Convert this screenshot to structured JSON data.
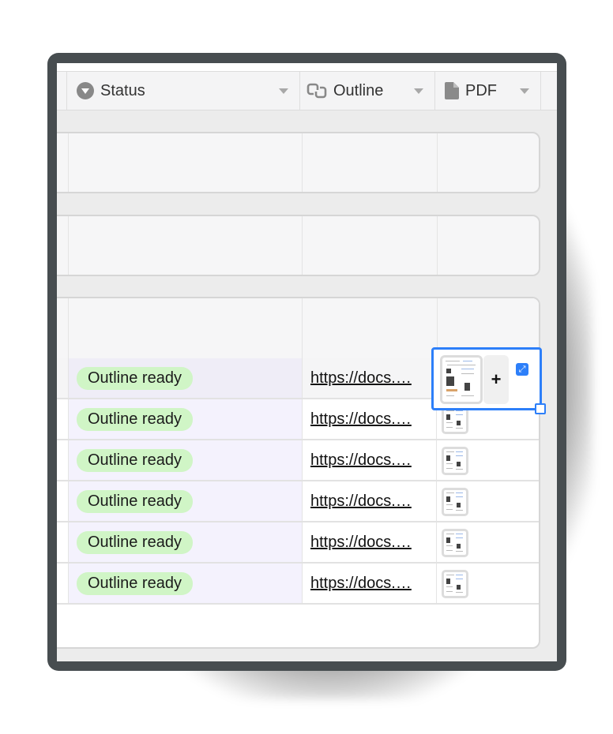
{
  "columns": [
    {
      "label": "Status",
      "icon": "single-select-icon"
    },
    {
      "label": "Outline",
      "icon": "link-icon"
    },
    {
      "label": "PDF",
      "icon": "document-icon"
    }
  ],
  "plus_label": "+",
  "expand_glyph": "⤢",
  "rows": [
    {
      "status": "Outline ready",
      "outline": "https://docs.…"
    },
    {
      "status": "Outline ready",
      "outline": "https://docs.…"
    },
    {
      "status": "Outline ready",
      "outline": "https://docs.…"
    },
    {
      "status": "Outline ready",
      "outline": "https://docs.…"
    },
    {
      "status": "Outline ready",
      "outline": "https://docs.…"
    },
    {
      "status": "Outline ready",
      "outline": "https://docs.…"
    }
  ],
  "colors": {
    "accent": "#2d7ff9",
    "status_pill": "#d0f5c6",
    "frame": "#474d50"
  }
}
